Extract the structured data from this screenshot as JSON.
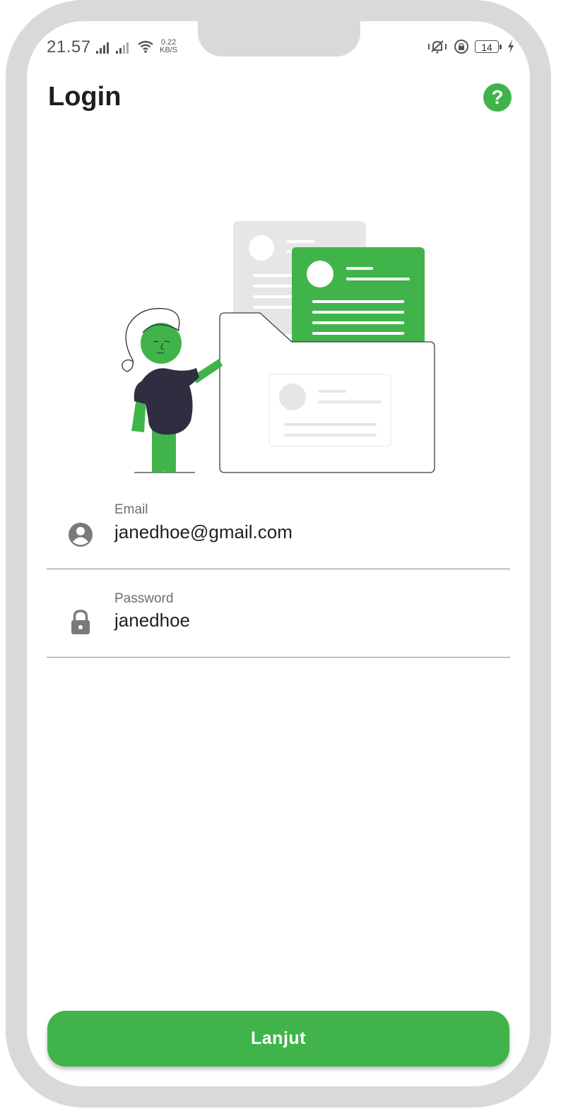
{
  "status_bar": {
    "time": "21.57",
    "net_speed_value": "0.22",
    "net_speed_unit": "KB/S",
    "battery_level": "14"
  },
  "header": {
    "title": "Login",
    "help_icon_glyph": "?"
  },
  "form": {
    "email": {
      "label": "Email",
      "value": "janedhoe@gmail.com",
      "icon": "account-circle-icon"
    },
    "password": {
      "label": "Password",
      "value": "janedhoe",
      "icon": "lock-icon"
    }
  },
  "submit_button": {
    "label": "Lanjut"
  },
  "colors": {
    "accent": "#40b44a",
    "frame": "#d9d9d9",
    "text_dark": "#1f1f1f",
    "figure_dark": "#2f2e41"
  }
}
